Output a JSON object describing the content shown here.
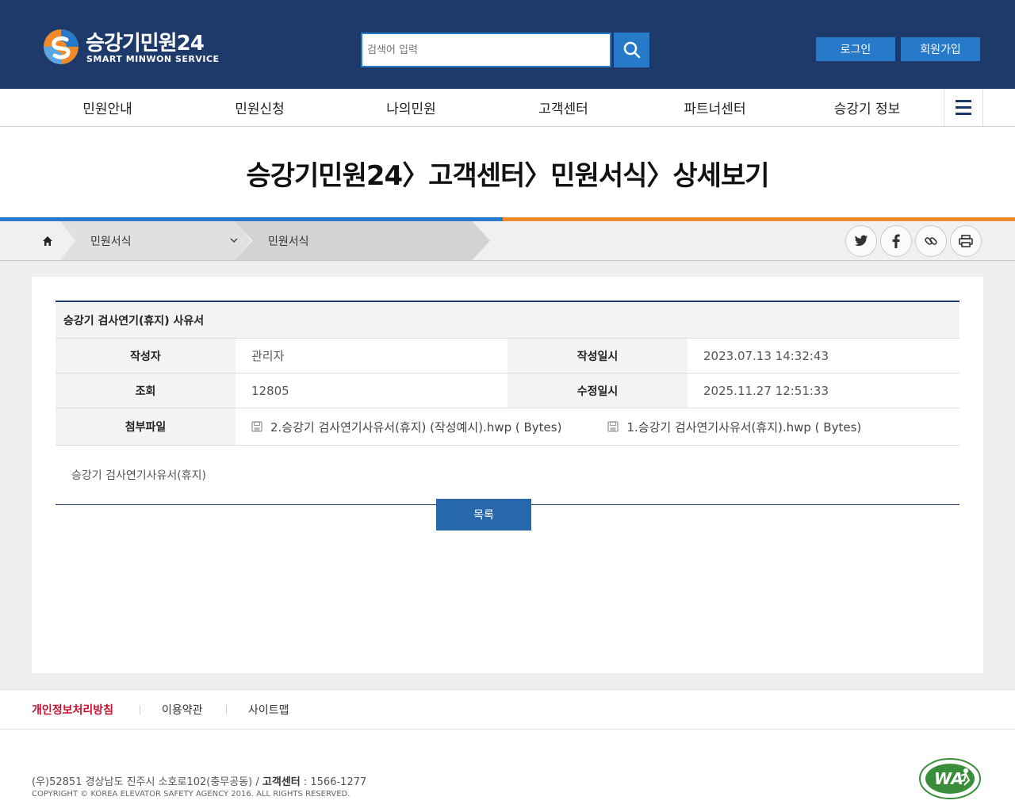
{
  "header": {
    "logo_title": "승강기민원24",
    "logo_subtitle": "SMART MINWON SERVICE",
    "search_placeholder": "검색어 입력",
    "login_label": "로그인",
    "join_label": "회원가입"
  },
  "nav": {
    "items": [
      "민원안내",
      "민원신청",
      "나의민원",
      "고객센터",
      "파트너센터",
      "승강기 정보"
    ]
  },
  "page_title": "승강기민원24〉고객센터〉민원서식〉상세보기",
  "breadcrumb": {
    "level1": "민원서식",
    "level2": "민원서식"
  },
  "share": {
    "icons": [
      "twitter-icon",
      "facebook-icon",
      "link-icon",
      "print-icon"
    ]
  },
  "post": {
    "title": "승강기 검사연기(휴지) 사유서",
    "author_label": "작성자",
    "author": "관리자",
    "created_label": "작성일시",
    "created": "2023.07.13 14:32:43",
    "views_label": "조회",
    "views": "12805",
    "modified_label": "수정일시",
    "modified": "2025.11.27 12:51:33",
    "attach_label": "첨부파일",
    "files": [
      "2.승강기 검사연기사유서(휴지) (작성예시).hwp ( Bytes)",
      "1.승강기 검사연기사유서(휴지).hwp ( Bytes)"
    ],
    "body": "승강기 검사연기사유서(휴지)",
    "list_button": "목록"
  },
  "footer": {
    "links": [
      "개인정보처리방침",
      "이용약관",
      "사이트맵"
    ],
    "address": "(우)52851 경상남도 진주시 소호로102(충무공동) / ",
    "cs_label": "고객센터",
    "cs_number": " : 1566-1277",
    "copyright": "COPYRIGHT © KOREA ELEVATOR SAFETY AGENCY 2016. ALL RIGHTS RESERVED.",
    "wa_mark_text": "WA"
  },
  "colors": {
    "header_bg": "#1e3a6b",
    "accent_blue": "#2779c9",
    "accent_orange": "#f08a2b",
    "footer_link_red": "#c8102e"
  }
}
